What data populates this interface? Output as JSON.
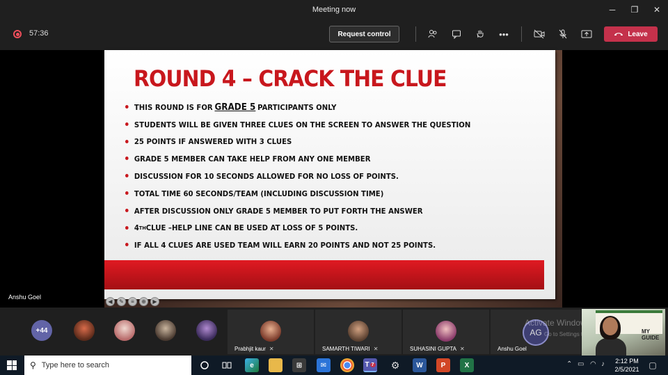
{
  "window": {
    "title": "Meeting now",
    "controls": [
      "─",
      "❐",
      "✕"
    ]
  },
  "toolbar": {
    "timer": "57:36",
    "request_control_label": "Request control",
    "leave_label": "Leave"
  },
  "slide": {
    "title": "ROUND 4 – CRACK THE CLUE",
    "bullets": [
      {
        "pre": "THIS ROUND IS FOR ",
        "emph": "GRADE 5",
        "post": " PARTICIPANTS ONLY"
      },
      {
        "text": "STUDENTS WILL BE GIVEN THREE CLUES ON THE SCREEN TO ANSWER THE QUESTION"
      },
      {
        "text": " 25 POINTS IF ANSWERED WITH 3 CLUES"
      },
      {
        "text": "GRADE 5 MEMBER CAN TAKE HELP FROM ANY ONE MEMBER"
      },
      {
        "text": "DISCUSSION FOR 10 SECONDS ALLOWED FOR NO LOSS OF POINTS."
      },
      {
        "text": "TOTAL TIME 60 SECONDS/TEAM (INCLUDING DISCUSSION TIME)"
      },
      {
        "text": "AFTER DISCUSSION ONLY GRADE 5 MEMBER TO PUT FORTH THE ANSWER"
      },
      {
        "pre": "4",
        "sup": "TH",
        "post": " CLUE –HELP LINE CAN BE USED AT LOSS OF 5 POINTS."
      },
      {
        "text": "IF ALL 4 CLUES ARE USED TEAM WILL EARN 20 POINTS AND NOT 25 POINTS."
      }
    ]
  },
  "presenter": {
    "name": "Anshu Goel"
  },
  "participants": {
    "more_count": "+44",
    "tiles": [
      {
        "name": "Prabhjit kaur"
      },
      {
        "name": "SAMARTH TIWARI"
      },
      {
        "name": "SUHASINI GUPTA"
      },
      {
        "name": "Anshu Goel",
        "initials": "AG"
      }
    ],
    "watermark": "Activate Windows",
    "watermark_sub": "Go to Settings to activate Windows.",
    "camera_banner_text": "MY GUIDE"
  },
  "taskbar": {
    "search_placeholder": "Type here to search",
    "time": "2:12 PM",
    "date": "2/5/2021",
    "teams_badge": "7"
  },
  "colors": {
    "accent_red": "#c8171d",
    "leave_red": "#c4314b",
    "teams_purple": "#6264a7"
  }
}
